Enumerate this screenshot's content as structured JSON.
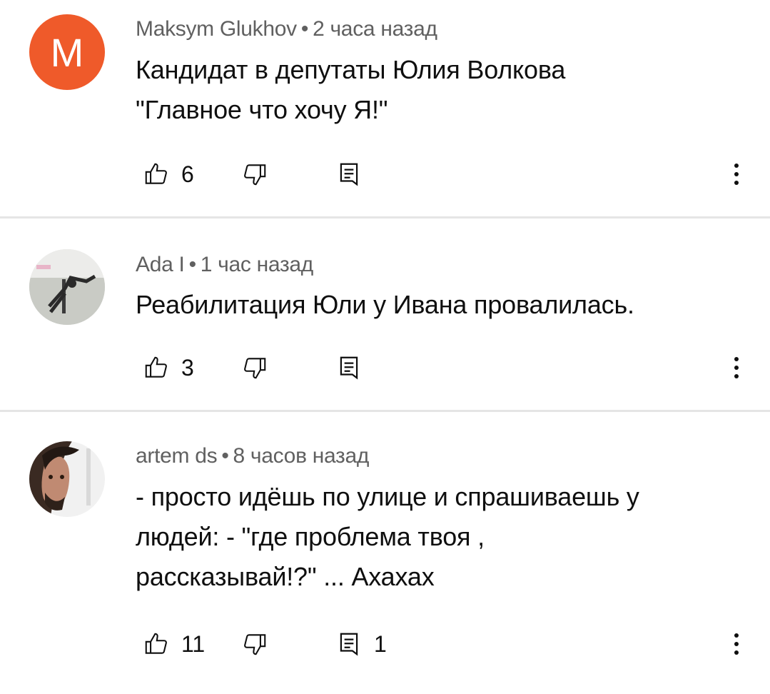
{
  "comments": [
    {
      "author": "Maksym Glukhov",
      "time": "2 часа назад",
      "avatar_letter": "M",
      "lines": [
        "Кандидат в депутаты Юлия Волкова",
        "\"Главное что хочу Я!\""
      ],
      "likes": "6",
      "replies": ""
    },
    {
      "author": "Ada I",
      "time": "1 час назад",
      "avatar_letter": "",
      "lines": [
        "Реабилитация Юли у Ивана провалилась."
      ],
      "likes": "3",
      "replies": ""
    },
    {
      "author": "artem ds",
      "time": "8 часов назад",
      "avatar_letter": "",
      "lines": [
        "- просто идёшь по улице и спрашиваешь у",
        "людей: - \"где проблема твоя ,",
        "рассказывай!?\" ... Ахахах"
      ],
      "likes": "11",
      "replies": "1"
    }
  ],
  "separator": "•",
  "icons": {
    "like": "thumbs-up-icon",
    "dislike": "thumbs-down-icon",
    "reply": "reply-icon",
    "more": "more-vertical-icon"
  },
  "colors": {
    "avatar_m": "#ef5a2a",
    "meta_text": "#606060",
    "divider": "#e5e5e5"
  }
}
